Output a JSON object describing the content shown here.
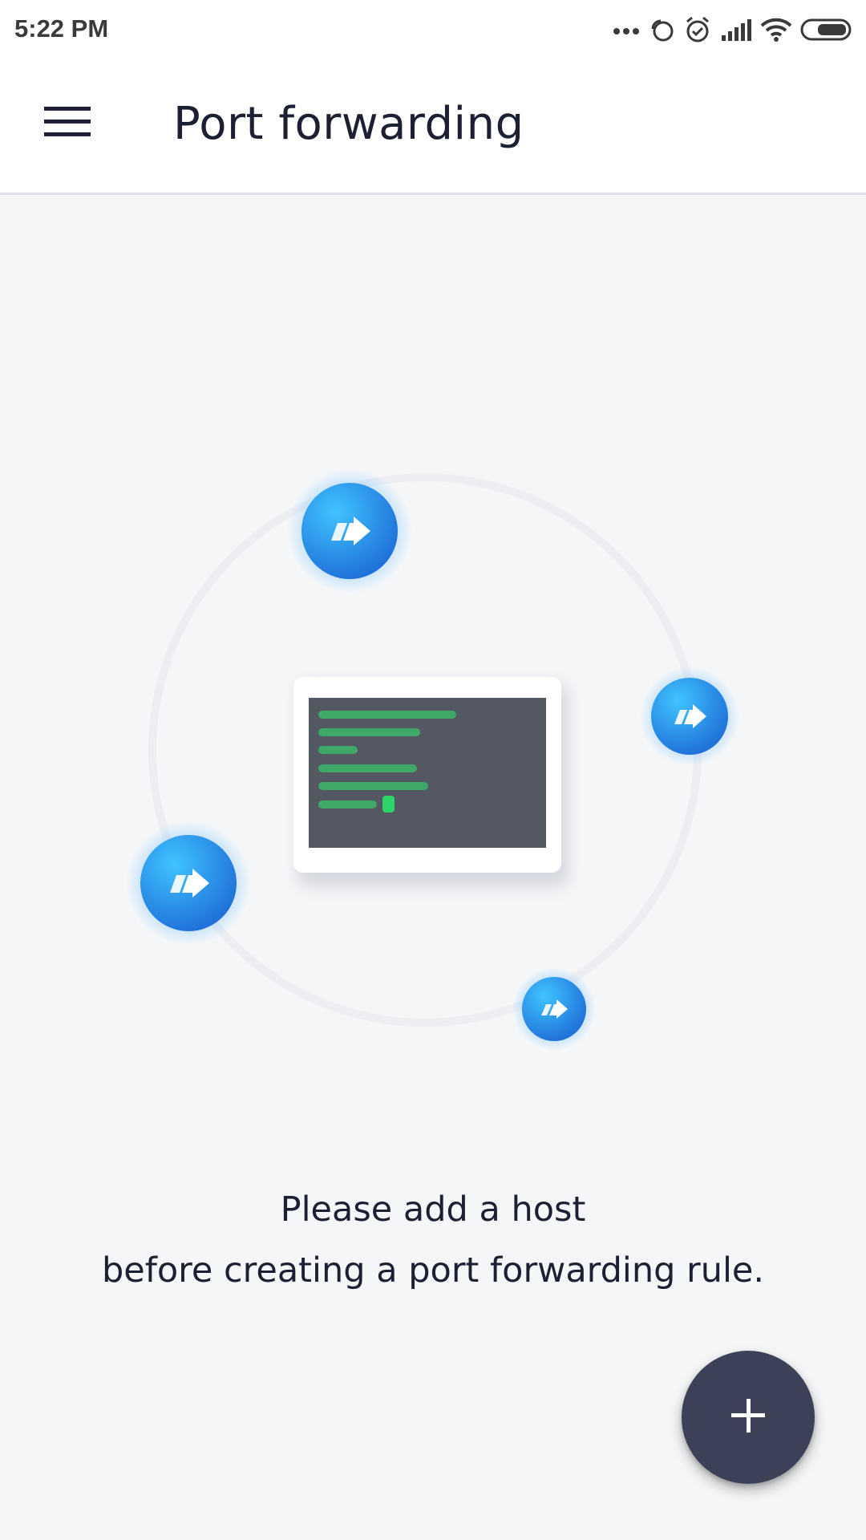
{
  "status_bar": {
    "time": "5:22 PM",
    "icons": [
      "more-dots-icon",
      "sync-icon",
      "alarm-icon",
      "signal-icon",
      "wifi-icon",
      "battery-icon"
    ]
  },
  "app_bar": {
    "title": "Port forwarding",
    "menu_icon": "hamburger-menu-icon"
  },
  "illustration": {
    "icons": [
      "terminal-window-icon",
      "forward-arrow-icon"
    ],
    "colors": {
      "node_blue": "#2a8de8",
      "terminal_bg": "#545862",
      "terminal_text": "#3fa868",
      "cursor": "#2ed36a"
    }
  },
  "empty_state": {
    "line1": "Please add a host",
    "line2": "before creating a port forwarding rule."
  },
  "fab": {
    "icon": "plus-icon",
    "color": "#3c4157"
  }
}
